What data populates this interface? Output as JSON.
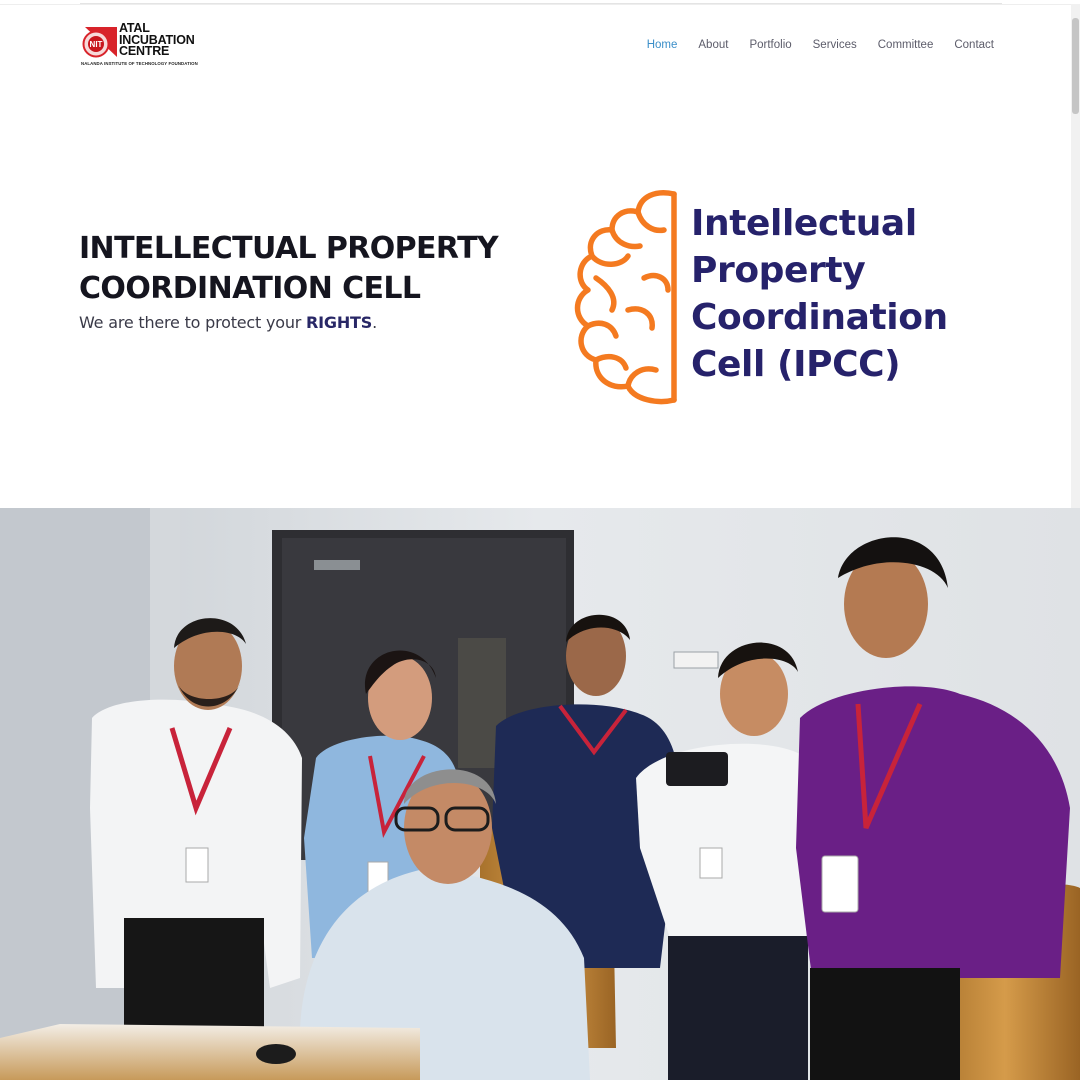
{
  "logo": {
    "line1": "ATAL",
    "line2": "INCUBATION",
    "line3": "CENTRE",
    "emblem_text": "NIT",
    "subtitle": "NALANDA INSTITUTE OF TECHNOLOGY FOUNDATION"
  },
  "nav": {
    "items": [
      {
        "label": "Home",
        "active": true
      },
      {
        "label": "About"
      },
      {
        "label": "Portfolio"
      },
      {
        "label": "Services"
      },
      {
        "label": "Committee"
      },
      {
        "label": "Contact"
      }
    ]
  },
  "hero": {
    "title_line1": "INTELLECTUAL PROPERTY",
    "title_line2": "COORDINATION CELL",
    "subtitle_prefix": "We are there to protect your ",
    "subtitle_emphasis": "RIGHTS",
    "subtitle_suffix": "."
  },
  "ipcc_logo": {
    "line1": "Intellectual",
    "line2": "Property",
    "line3": "Coordination",
    "line4": "Cell (IPCC)"
  },
  "colors": {
    "nav_active": "#3a8ec8",
    "nav_text": "#5c5c6a",
    "brand_navy": "#26226b",
    "brain_orange": "#f47a20",
    "logo_red": "#d8232a"
  }
}
